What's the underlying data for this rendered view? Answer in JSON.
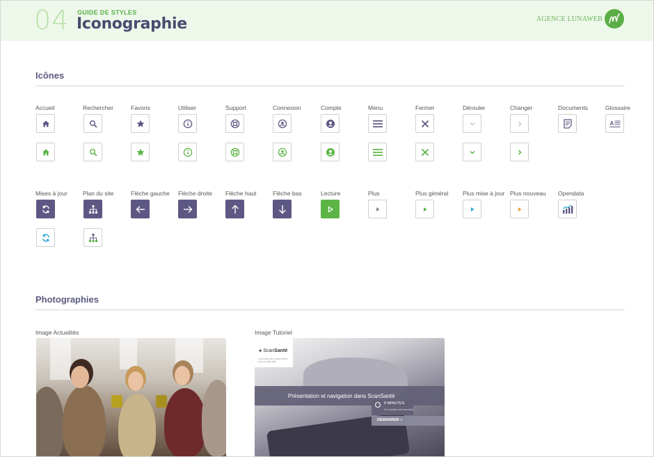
{
  "header": {
    "number": "04",
    "kicker": "GUIDE DE STYLES",
    "title": "Iconographie",
    "agency": "AGENCE LUNAWEB",
    "logo_icon": "lunaweb-logo-icon"
  },
  "sections": {
    "icons_title": "Icônes",
    "photos_title": "Photographies"
  },
  "icon_row1": [
    {
      "label": "Accueil",
      "icon": "home-icon"
    },
    {
      "label": "Rechercher",
      "icon": "search-icon"
    },
    {
      "label": "Favoris",
      "icon": "star-icon"
    },
    {
      "label": "Utiliser",
      "icon": "info-icon"
    },
    {
      "label": "Support",
      "icon": "lifebuoy-icon"
    },
    {
      "label": "Connexion",
      "icon": "user-circle-icon"
    },
    {
      "label": "Compte",
      "icon": "account-icon"
    },
    {
      "label": "Menu",
      "icon": "menu-icon"
    },
    {
      "label": "Fermer",
      "icon": "close-icon"
    },
    {
      "label": "Dérouler",
      "icon": "chevron-down-icon"
    },
    {
      "label": "Changer",
      "icon": "chevron-right-icon"
    },
    {
      "label": "Documents",
      "icon": "document-icon"
    },
    {
      "label": "Glossaire",
      "icon": "glossary-icon"
    }
  ],
  "icon_row3": [
    {
      "label": "Mises à jour",
      "icon": "refresh-icon"
    },
    {
      "label": "Plan du site",
      "icon": "sitemap-icon"
    },
    {
      "label": "Flèche gauche",
      "icon": "arrow-left-icon"
    },
    {
      "label": "Flèche droite",
      "icon": "arrow-right-icon"
    },
    {
      "label": "Flèche haut",
      "icon": "arrow-up-icon"
    },
    {
      "label": "Flèche bas",
      "icon": "arrow-down-icon"
    },
    {
      "label": "Lecture",
      "icon": "play-icon"
    },
    {
      "label": "Plus",
      "icon": "play-small-icon"
    },
    {
      "label": "Plus général",
      "icon": "play-small-icon"
    },
    {
      "label": "Plus mise à jour",
      "icon": "play-small-icon"
    },
    {
      "label": "Plus nouveau",
      "icon": "play-small-icon"
    },
    {
      "label": "Opendata",
      "icon": "bar-chart-icon"
    }
  ],
  "colors": {
    "primary_purple": "#5d5883",
    "green": "#5cb446",
    "light_green": "#b9e0a8",
    "blue": "#2aa3d6",
    "orange": "#f0a030",
    "grey": "#8a8a8a"
  },
  "photos": {
    "news_label": "Image Actualités",
    "tutorial_label": "Image Tutoriel",
    "tutorial": {
      "brand": "ScanSanté",
      "brand_prefix": "Scan",
      "brand_suffix": "Santé",
      "brand_sub": "Les outils pour comprendre une donnée utile",
      "headline": "Présentation et navigation dans ScanSanté",
      "duration": "8 MINUTES",
      "duration_note": "Ce module est sonorisé",
      "cta": "DÉMARRER »"
    }
  }
}
